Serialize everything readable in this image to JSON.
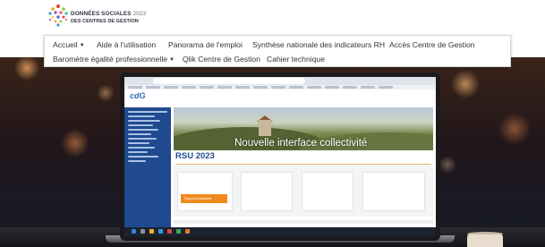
{
  "logo": {
    "line1_main": "DONNÉES SOCIALES",
    "line1_year": "2023",
    "line2": "DES CENTRES DE GESTION",
    "dot_colors": [
      "#e63b2e",
      "#f2a623",
      "#8dc63f",
      "#3d9ad9",
      "#9b59b6",
      "#f05a8a",
      "#2ebfa5",
      "#ffd23a",
      "#5b6bd5"
    ]
  },
  "nav": {
    "row1": [
      {
        "label": "Accueil",
        "dropdown": true
      },
      {
        "label": "Aide à l'utilisation",
        "dropdown": false
      },
      {
        "label": "Panorama de l'emploi",
        "dropdown": false
      },
      {
        "label": "Synthèse nationale des indicateurs RH",
        "dropdown": false
      },
      {
        "label": "Accès Centre de Gestion",
        "dropdown": false
      }
    ],
    "row2": [
      {
        "label": "Baromètre égalité professionnelle",
        "dropdown": true
      },
      {
        "label": "Qlik Centre de Gestion",
        "dropdown": false
      },
      {
        "label": "Cahier technique",
        "dropdown": false
      }
    ]
  },
  "hero_screen": {
    "app_logo": "cdG",
    "banner_title": "Nouvelle interface collectivité",
    "section_title": "RSU 2023",
    "card_action": "Rapport d'instantané"
  },
  "colors": {
    "nav_text": "#333333",
    "brand_blue": "#1f4a8f",
    "accent_orange": "#f08a1e"
  }
}
